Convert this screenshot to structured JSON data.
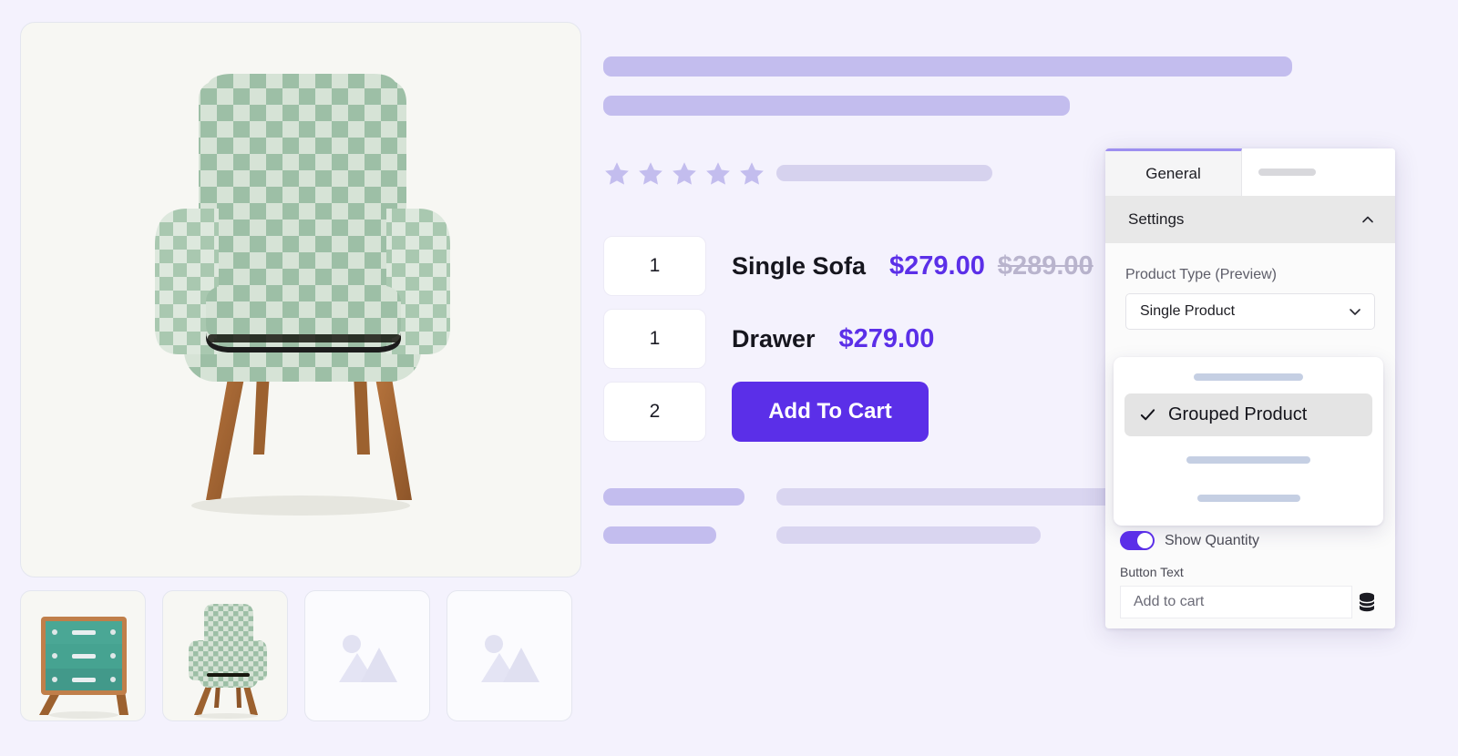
{
  "theme": {
    "page_bg": "#f4f2fd",
    "accent": "#5b2fe8",
    "skeleton": "#c3bdee",
    "panel_bg": "#fbfbfb"
  },
  "gallery": {
    "main_image_alt": "green gingham armchair with wooden legs",
    "thumbnails": [
      {
        "alt": "teal three-drawer dresser",
        "type": "image"
      },
      {
        "alt": "green gingham armchair",
        "type": "image"
      },
      {
        "alt": "image placeholder",
        "type": "placeholder"
      },
      {
        "alt": "image placeholder",
        "type": "placeholder"
      }
    ]
  },
  "product": {
    "rating_stars": 5,
    "rows": [
      {
        "qty": "1",
        "name": "Single Sofa",
        "price": "$279.00",
        "price_old": "$289.00"
      },
      {
        "qty": "1",
        "name": "Drawer",
        "price": "$279.00",
        "price_old": ""
      },
      {
        "qty": "2",
        "name": "",
        "price": "",
        "price_old": ""
      }
    ],
    "add_to_cart_label": "Add To Cart"
  },
  "panel": {
    "tabs": [
      {
        "label": "General",
        "active": true
      },
      {
        "label": "",
        "active": false
      }
    ],
    "section": {
      "title": "Settings",
      "expanded": true,
      "chevron": "chevron-up-icon"
    },
    "product_type": {
      "label": "Product Type (Preview)",
      "value": "Single Product",
      "chevron": "chevron-down-icon"
    },
    "dropdown": {
      "open": true,
      "selected_label": "Grouped Product",
      "check": "check-icon"
    },
    "show_quantity": {
      "label": "Show Quantity",
      "enabled": true
    },
    "button_text": {
      "label": "Button Text",
      "value": "Add to cart",
      "placeholder": "Add to cart"
    },
    "database_icon": "database-icon"
  }
}
